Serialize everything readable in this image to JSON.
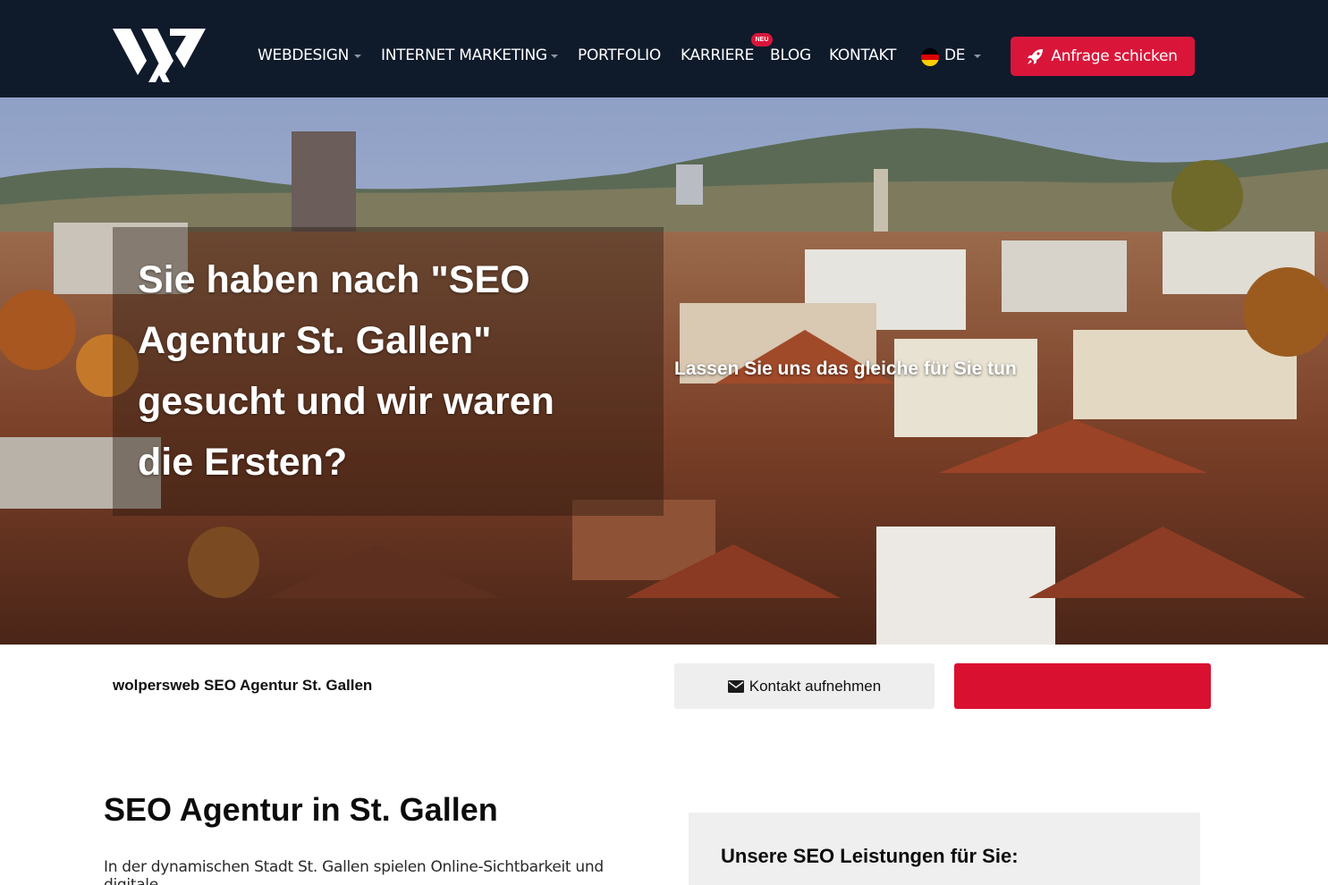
{
  "header": {
    "logo_alt": "wolpersweb logo",
    "nav": [
      {
        "label": "WEBDESIGN",
        "dropdown": true
      },
      {
        "label": "INTERNET MARKETING",
        "dropdown": true
      },
      {
        "label": "PORTFOLIO",
        "dropdown": false
      },
      {
        "label": "KARRIERE",
        "dropdown": false,
        "badge": "NEU"
      },
      {
        "label": "BLOG",
        "dropdown": false
      },
      {
        "label": "KONTAKT",
        "dropdown": false
      }
    ],
    "language": {
      "label": "DE",
      "flag_icon": "germany-flag-icon"
    },
    "cta_label": "Anfrage schicken",
    "cta_icon": "rocket-icon"
  },
  "hero": {
    "title": "Sie haben nach \"SEO Agentur St. Gallen\" gesucht und wir waren die Ersten?",
    "subtitle": "Lassen Sie uns das gleiche für Sie tun"
  },
  "strip": {
    "title": "wolpersweb SEO Agentur St. Gallen",
    "contact_label": "Kontakt aufnehmen",
    "contact_icon": "envelope-icon"
  },
  "content": {
    "title": "SEO Agentur in St. Gallen",
    "text": "In der dynamischen Stadt St. Gallen spielen Online-Sichtbarkeit und digitale",
    "services_title": "Unsere SEO Leistungen für Sie:"
  },
  "colors": {
    "header_bg": "#0f1a2b",
    "accent_red": "#d9163a",
    "light_gray": "#eeeeee"
  }
}
